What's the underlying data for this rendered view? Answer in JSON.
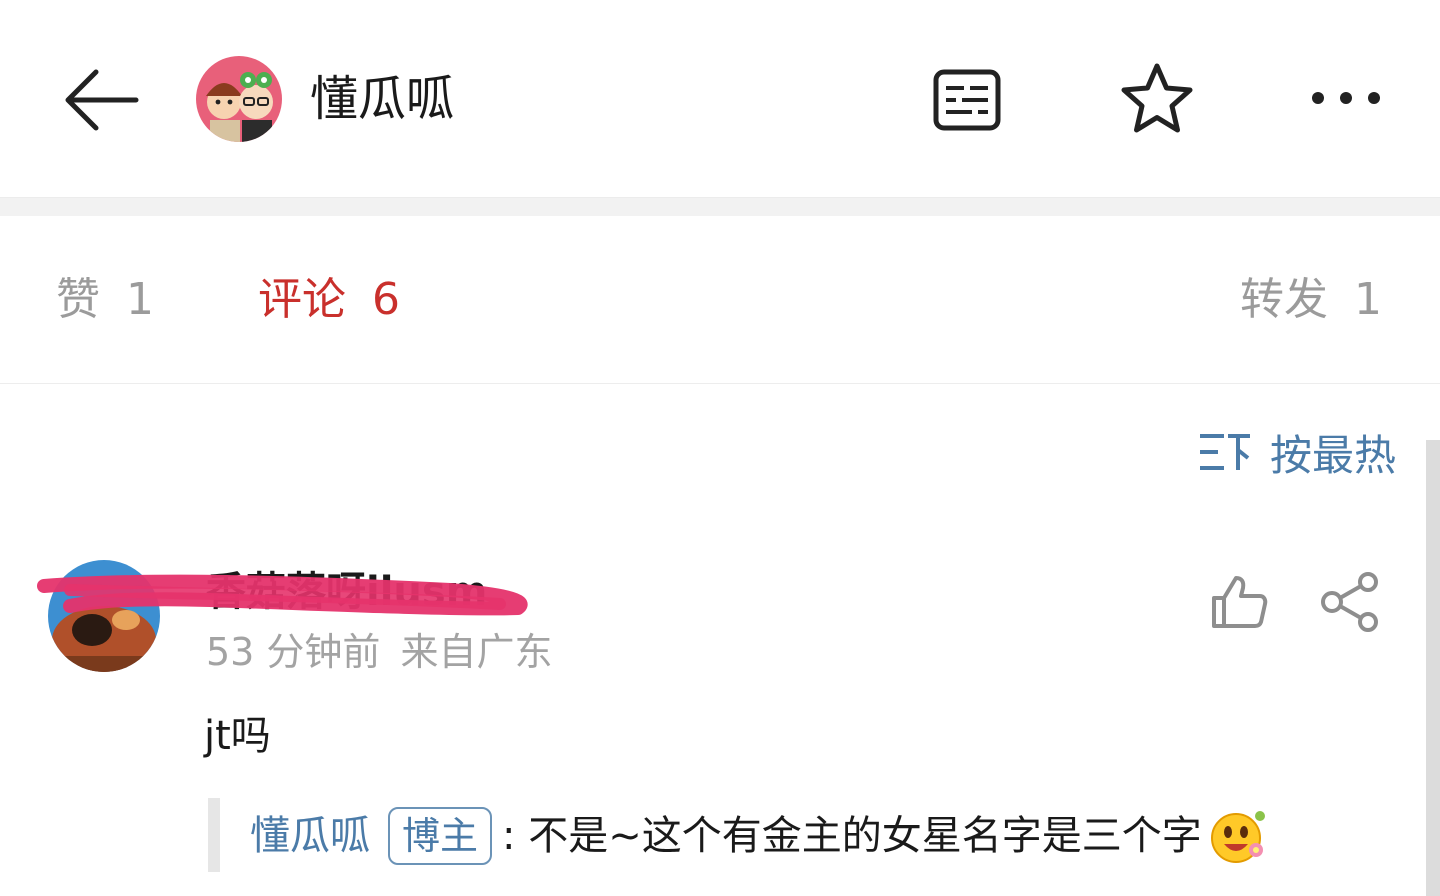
{
  "header": {
    "title": "懂瓜呱",
    "back_icon": "arrow-left-icon",
    "reader_icon": "reader-mode-icon",
    "favorite_icon": "star-icon",
    "more_icon": "more-horizontal-icon"
  },
  "tabs": [
    {
      "label": "赞",
      "count": "1",
      "active": false
    },
    {
      "label": "评论",
      "count": "6",
      "active": true
    },
    {
      "label": "转发",
      "count": "1",
      "active": false
    }
  ],
  "sort": {
    "label": "按最热",
    "icon": "sort-icon"
  },
  "comment": {
    "author": "香菇落呀ilusm",
    "time": "53 分钟前",
    "location": "来自广东",
    "text": "jt吗",
    "like_icon": "thumbs-up-icon",
    "share_icon": "share-icon",
    "reply": {
      "author": "懂瓜呱",
      "badge": "博主",
      "text": ": 不是~这个有金主的女星名字是三个字",
      "emoji": "flower-smile-emoji-icon"
    }
  },
  "colors": {
    "accent_red": "#c9302c",
    "link_blue": "#4b7ba8",
    "muted_gray": "#9b9b9b",
    "redaction_pink": "#e5336b"
  }
}
